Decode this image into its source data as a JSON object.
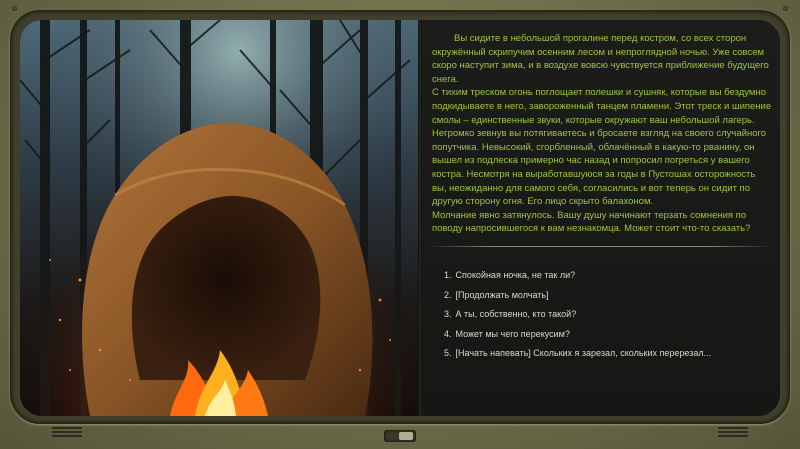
{
  "story": {
    "paragraphs": [
      "Вы сидите в небольшой прогалине перед костром, со всех сторон окружённый скрипучим осенним лесом и непроглядной ночью. Уже совсем скоро наступит зима, и в воздухе вовсю чувствуется приближение будущего снега.",
      "С тихим треском огонь поглощает полешки и сушняк, которые вы бездумно подкидываете в него, завороженный танцем пламени. Этот треск и шипение смолы – единственные звуки, которые окружают ваш небольшой лагерь.",
      "Негромко зевнув вы потягиваетесь и бросаете взгляд на своего случайного попутчика. Невысокий, сгорбленный, облачённый в какую-то рванину, он вышел из подлеска примерно час назад и попросил погреться у вашего костра. Несмотря на выработавшуюся за годы в Пустошах осторожность вы, неожиданно для самого себя, согласились и вот теперь он сидит по другую сторону огня. Его лицо скрыто балахоном.",
      "Молчание явно затянулось. Вашу душу начинают терзать сомнения по поводу напросившегося к вам незнакомца. Может стоит что-то сказать?"
    ]
  },
  "choices": [
    {
      "num": "1.",
      "text": "Спокойная ночка, не так ли?"
    },
    {
      "num": "2.",
      "text": "[Продолжать молчать]"
    },
    {
      "num": "3.",
      "text": "А ты, собственно, кто такой?"
    },
    {
      "num": "4.",
      "text": "Может мы чего перекусим?"
    },
    {
      "num": "5.",
      "text": "[Начать напевать] Скольких я зарезал, скольких перерезал..."
    }
  ],
  "colors": {
    "story_text": "#9ec63c",
    "choice_text": "#d8d8cc",
    "frame": "#6e6e4a"
  }
}
